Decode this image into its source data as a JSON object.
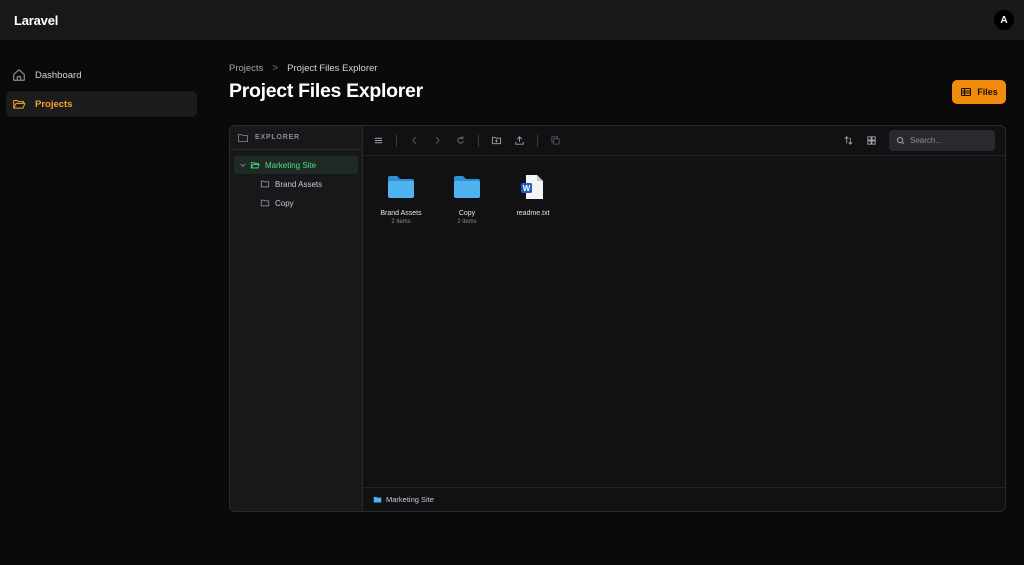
{
  "app": {
    "brand": "Laravel",
    "avatar_initial": "A"
  },
  "sidebar": {
    "items": [
      {
        "label": "Dashboard",
        "icon": "home-icon",
        "active": false
      },
      {
        "label": "Projects",
        "icon": "folder-icon",
        "active": true
      }
    ]
  },
  "breadcrumb": {
    "parent": "Projects",
    "separator": ">",
    "current": "Project Files Explorer"
  },
  "page": {
    "title": "Project Files Explorer"
  },
  "header_button": {
    "label": "Files",
    "icon": "table-icon"
  },
  "explorer": {
    "heading": "EXPLORER",
    "tree": {
      "root": "Marketing Site",
      "children": [
        "Brand Assets",
        "Copy"
      ]
    },
    "search": {
      "placeholder": "Search...",
      "value": ""
    },
    "items": [
      {
        "name": "Brand Assets",
        "meta": "2 items",
        "type": "folder"
      },
      {
        "name": "Copy",
        "meta": "2 items",
        "type": "folder"
      },
      {
        "name": "readme.txt",
        "meta": "",
        "type": "word-document"
      }
    ],
    "status_path": "Marketing Site"
  },
  "colors": {
    "accent": "#f28c0f",
    "active_nav": "#f5a623",
    "tree_active": "#4ade80",
    "folder": "#4fb3f0"
  }
}
